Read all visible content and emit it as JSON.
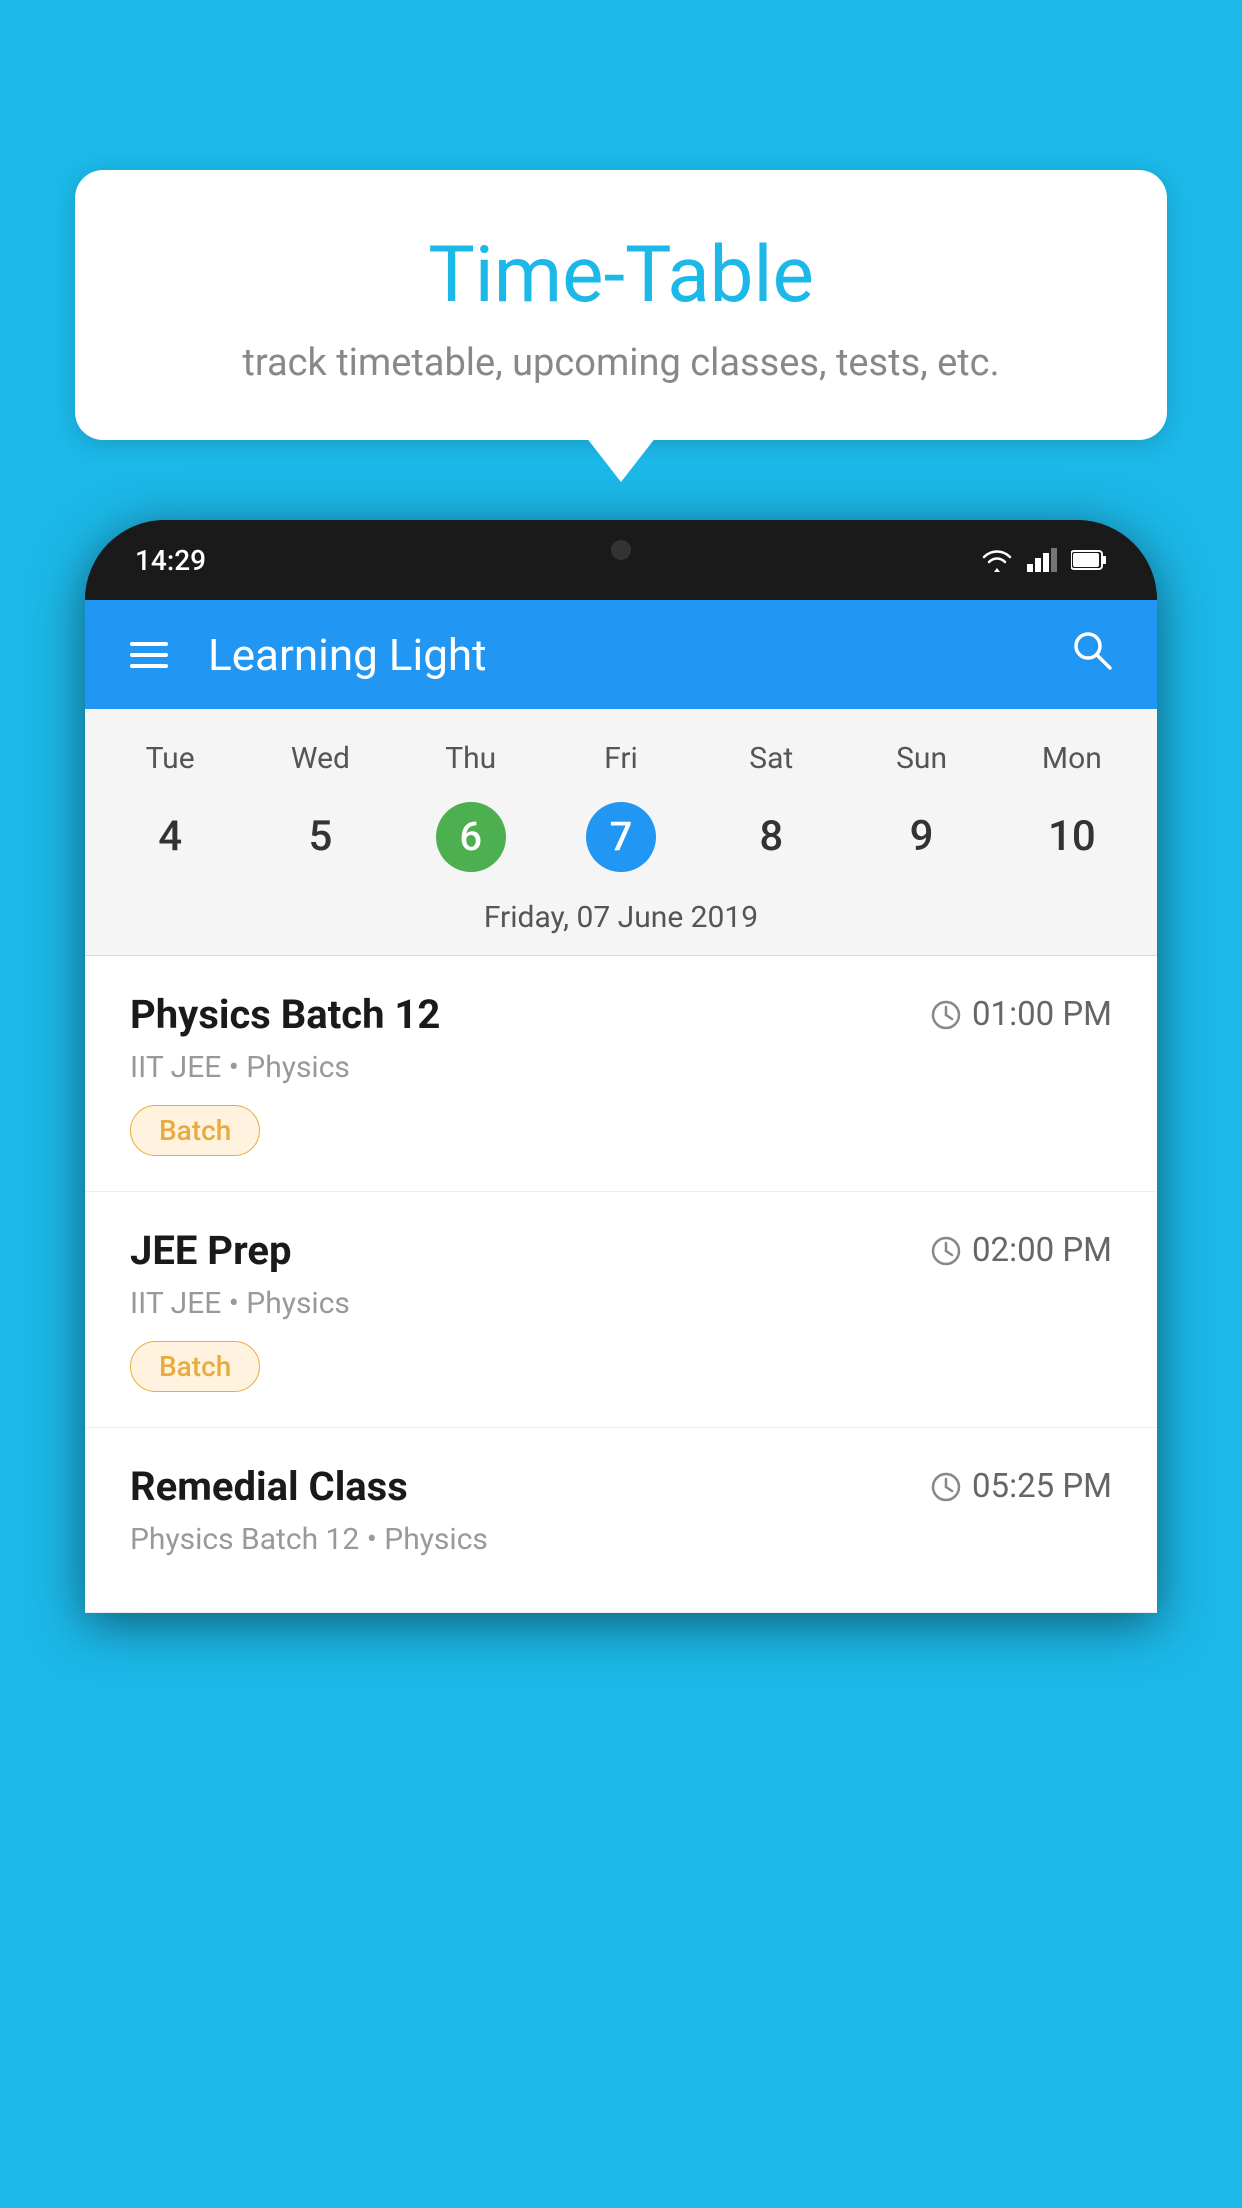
{
  "background": {
    "color": "#1CB8E8"
  },
  "tooltip": {
    "title": "Time-Table",
    "subtitle": "track timetable, upcoming classes, tests, etc."
  },
  "status_bar": {
    "time": "14:29",
    "icons": [
      "wifi",
      "signal",
      "battery"
    ]
  },
  "app_header": {
    "title": "Learning Light",
    "search_icon": "search"
  },
  "calendar": {
    "days_of_week": [
      "Tue",
      "Wed",
      "Thu",
      "Fri",
      "Sat",
      "Sun",
      "Mon"
    ],
    "dates": [
      "4",
      "5",
      "6",
      "7",
      "8",
      "9",
      "10"
    ],
    "today_index": 2,
    "selected_index": 3,
    "selected_label": "Friday, 07 June 2019"
  },
  "schedule": [
    {
      "title": "Physics Batch 12",
      "time": "01:00 PM",
      "meta": "IIT JEE • Physics",
      "badge": "Batch"
    },
    {
      "title": "JEE Prep",
      "time": "02:00 PM",
      "meta": "IIT JEE • Physics",
      "badge": "Batch"
    },
    {
      "title": "Remedial Class",
      "time": "05:25 PM",
      "meta": "Physics Batch 12 • Physics",
      "badge": ""
    }
  ]
}
